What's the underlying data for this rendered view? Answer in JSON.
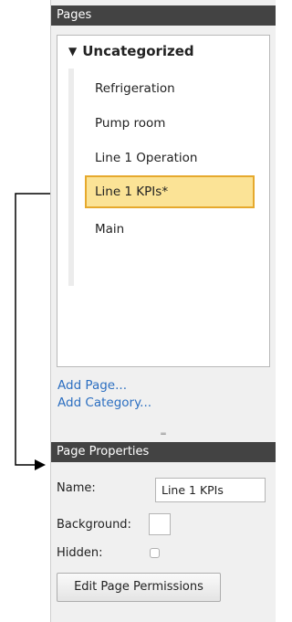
{
  "pages_panel": {
    "title": "Pages",
    "category": {
      "expander_icon": "triangle-down",
      "label": "Uncategorized"
    },
    "pages": [
      {
        "label": "Refrigeration",
        "selected": false
      },
      {
        "label": "Pump room",
        "selected": false
      },
      {
        "label": "Line 1 Operation",
        "selected": false
      },
      {
        "label": "Line 1 KPIs*",
        "selected": true
      },
      {
        "label": "Main",
        "selected": false
      }
    ],
    "add_page": "Add Page...",
    "add_category": "Add Category...",
    "splitter_glyph": "═"
  },
  "properties_panel": {
    "title": "Page Properties",
    "name_label": "Name:",
    "name_value": "Line 1 KPIs",
    "background_label": "Background:",
    "background_color": "#ffffff",
    "hidden_label": "Hidden:",
    "hidden_checked": false,
    "edit_permissions_button": "Edit Page Permissions"
  },
  "colors": {
    "header_bg": "#434343",
    "selected_fill": "#fbe396",
    "selected_border": "#e6a92d",
    "link": "#2c6fc1"
  }
}
